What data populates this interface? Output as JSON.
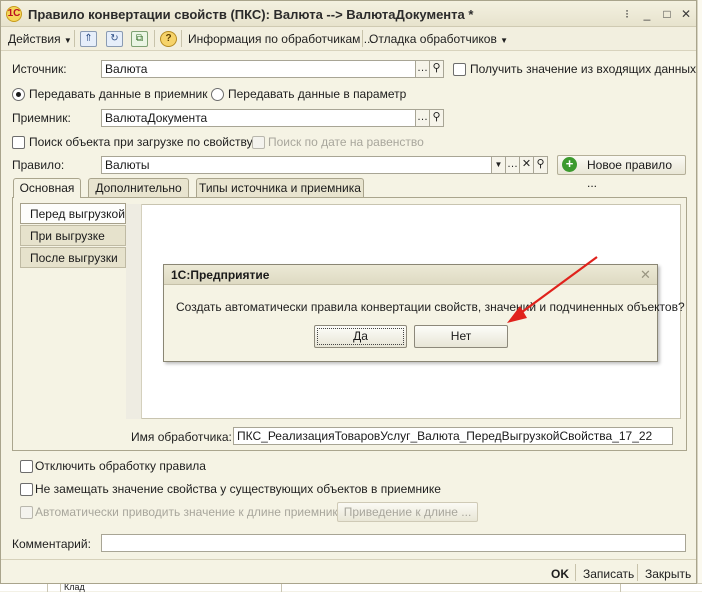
{
  "window": {
    "title": "Правило конвертации свойств (ПКС): Валюта --> ВалютаДокумента *",
    "app_icon": "1С",
    "minimize": "_",
    "maximize": "□",
    "close": "✕",
    "extra": "⁝"
  },
  "toolbar": {
    "actions": "Действия",
    "handlers_info": "Информация по обработчикам ...",
    "debug": "Отладка обработчиков"
  },
  "form": {
    "source_label": "Источник:",
    "source_value": "Валюта",
    "get_from_incoming": "Получить значение из входящих данных",
    "radio_receiver": "Передавать данные в приемник",
    "radio_param": "Передавать данные в параметр",
    "receiver_label": "Приемник:",
    "receiver_value": "ВалютаДокумента",
    "search_by_property": "Поиск объекта при загрузке по свойству",
    "search_by_date": "Поиск по дате на равенство",
    "rule_label": "Правило:",
    "rule_value": "Валюты",
    "new_rule": "Новое правило ..."
  },
  "tabs": [
    "Основная",
    "Дополнительно",
    "Типы источника и приемника"
  ],
  "vtabs": [
    "Перед выгрузкой",
    "При выгрузке",
    "После выгрузки"
  ],
  "handler": {
    "label": "Имя обработчика:",
    "value": "ПКС_РеализацияТоваровУслуг_Валюта_ПередВыгрузкойСвойства_17_22"
  },
  "options": {
    "disable_rule": "Отключить обработку правила",
    "no_replace": "Не замещать значение свойства у существующих объектов в приемнике",
    "auto_length": "Автоматически приводить значение к длине приемника",
    "length_btn": "Приведение к длине ..."
  },
  "comment_label": "Комментарий:",
  "footer": {
    "ok": "OK",
    "save": "Записать",
    "close": "Закрыть"
  },
  "dialog": {
    "title": "1С:Предприятие",
    "message": "Создать автоматически правила конвертации свойств, значений и подчиненных объектов?",
    "yes": "Да",
    "no": "Нет",
    "close": "✕"
  },
  "background": {
    "fragment": "Клад"
  },
  "colors": {
    "arrow": "#e0221c",
    "accent_green": "#3c9a2e"
  }
}
